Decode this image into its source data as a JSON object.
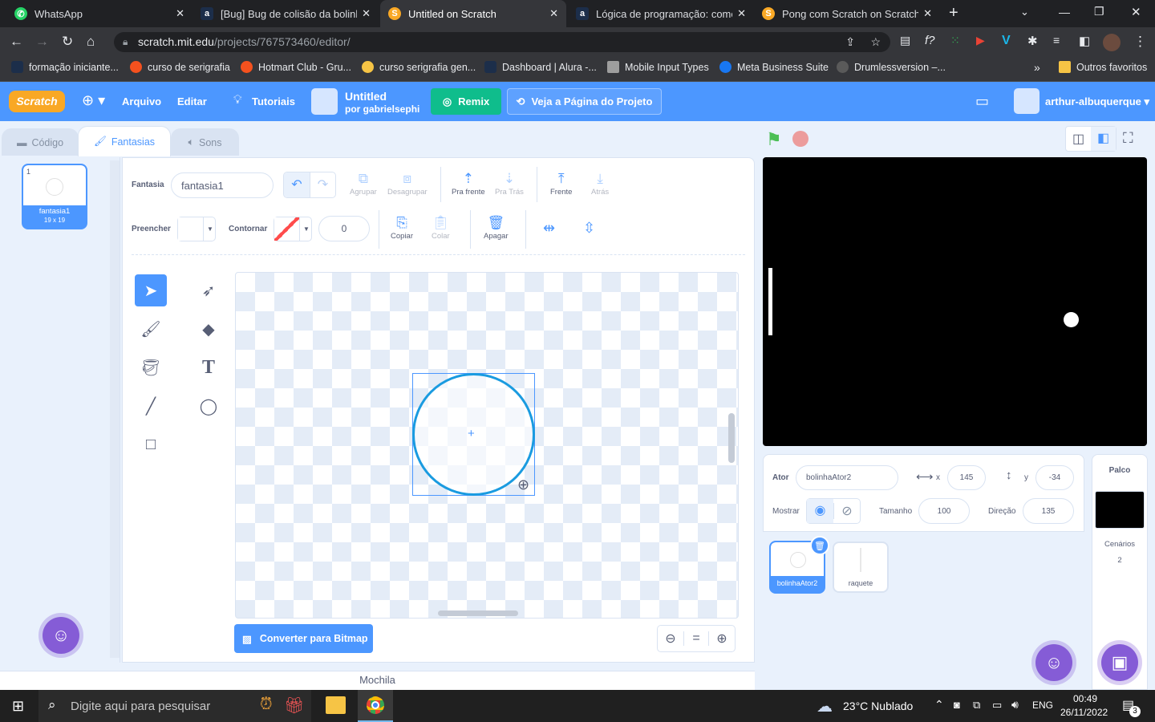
{
  "browser": {
    "tabs": [
      {
        "title": "WhatsApp",
        "icon": "whatsapp-icon"
      },
      {
        "title": "[Bug] Bug de colisão da bolinha",
        "icon": "alura-icon"
      },
      {
        "title": "Untitled on Scratch",
        "icon": "scratch-icon"
      },
      {
        "title": "Lógica de programação: começ",
        "icon": "alura-icon"
      },
      {
        "title": "Pong com Scratch on Scratch",
        "icon": "scratch-icon"
      }
    ],
    "url_host": "scratch.mit.edu",
    "url_path": "/projects/767573460/editor/",
    "bookmarks": [
      "formação iniciante...",
      "curso de serigrafia",
      "Hotmart Club - Gru...",
      "curso serigrafia gen...",
      "Dashboard | Alura -...",
      "Mobile Input Types",
      "Meta Business Suite",
      "Drumlessversion –..."
    ],
    "more_bookmarks": "»",
    "other_favorites": "Outros favoritos"
  },
  "scratch": {
    "logo": "Scratch",
    "menu": {
      "file": "Arquivo",
      "edit": "Editar",
      "tutorials": "Tutoriais"
    },
    "project": {
      "title": "Untitled",
      "by": "por gabrielsephi"
    },
    "remix": "Remix",
    "see_page": "Veja a Página do Projeto",
    "username": "arthur-albuquerque",
    "tabs": {
      "code": "Código",
      "costumes": "Fantasias",
      "sounds": "Sons"
    },
    "costume_item": {
      "number": "1",
      "name": "fantasia1",
      "size": "19 x 19"
    },
    "editor": {
      "costume_label": "Fantasia",
      "costume_name": "fantasia1",
      "group": "Agrupar",
      "ungroup": "Desagrupar",
      "forward": "Pra frente",
      "backward": "Pra Trás",
      "front": "Frente",
      "back": "Atrás",
      "fill": "Preencher",
      "outline": "Contornar",
      "outline_width": "0",
      "copy": "Copiar",
      "paste": "Colar",
      "delete": "Apagar",
      "convert_bitmap": "Converter para Bitmap",
      "zoom_reset": "="
    },
    "backpack": "Mochila",
    "sprite_info": {
      "sprite_label": "Ator",
      "sprite_name": "bolinhaAtor2",
      "x_label": "x",
      "x": "145",
      "y_label": "y",
      "y": "-34",
      "show_label": "Mostrar",
      "size_label": "Tamanho",
      "size": "100",
      "direction_label": "Direção",
      "direction": "135"
    },
    "sprites": [
      {
        "name": "bolinhaAtor2",
        "selected": true
      },
      {
        "name": "raquete",
        "selected": false
      }
    ],
    "stage_panel": {
      "title": "Palco",
      "backdrops_label": "Cenários",
      "backdrops_count": "2"
    }
  },
  "taskbar": {
    "search_placeholder": "Digite aqui para pesquisar",
    "weather": "23°C  Nublado",
    "lang": "ENG",
    "time": "00:49",
    "date": "26/11/2022",
    "notifications": "3"
  },
  "colors": {
    "scratch_blue": "#4c97ff",
    "remix_green": "#0fbd8c",
    "chrome_dark": "#202124"
  }
}
